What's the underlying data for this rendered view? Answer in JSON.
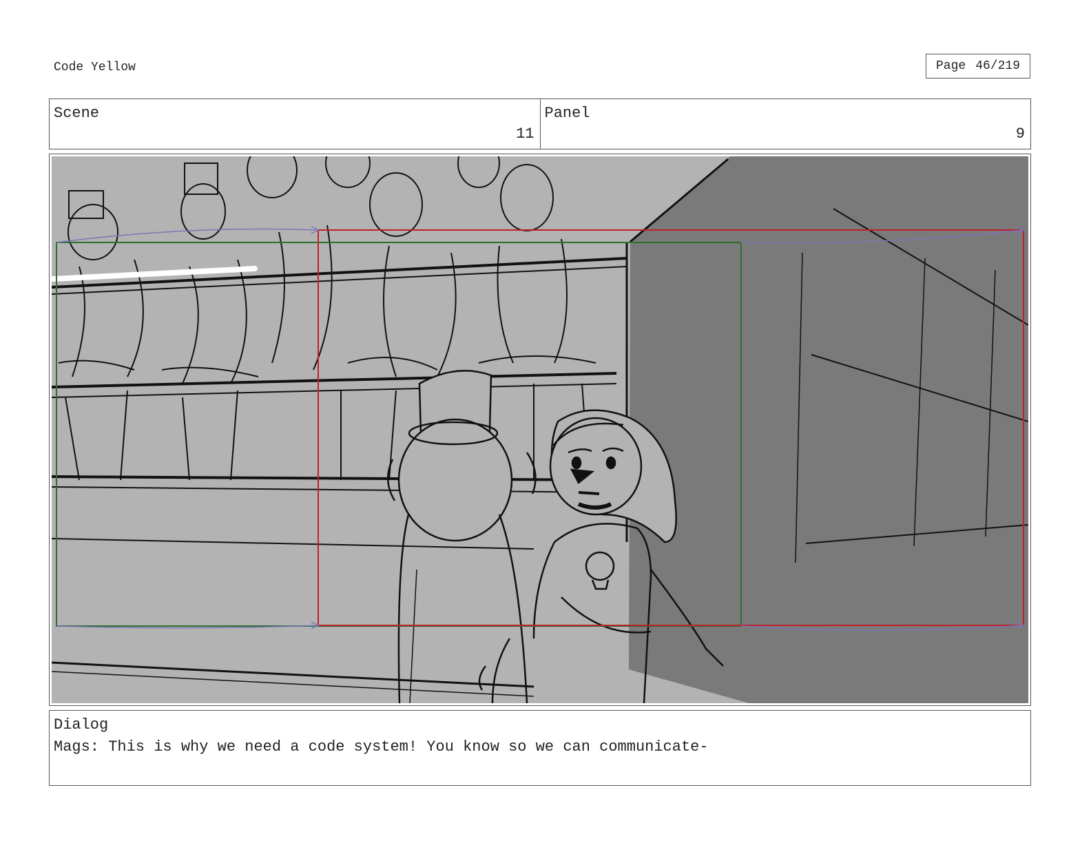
{
  "header": {
    "project_title": "Code Yellow",
    "page_label": "Page",
    "page_number": "46/219"
  },
  "scene": {
    "label": "Scene",
    "value": "11"
  },
  "panel": {
    "label": "Panel",
    "value": "9"
  },
  "dialog": {
    "label": "Dialog",
    "text": "Mags: This is why we need a code system! You know so we can communicate-"
  },
  "artwork": {
    "background_color": "#b3b3b3",
    "wall_color": "#7a7a7a",
    "line_color": "#111111",
    "camera_start_frame_color": "#2e6e2e",
    "camera_end_frame_color": "#c0202a",
    "camera_motion_arrow_color": "#7878b8"
  }
}
